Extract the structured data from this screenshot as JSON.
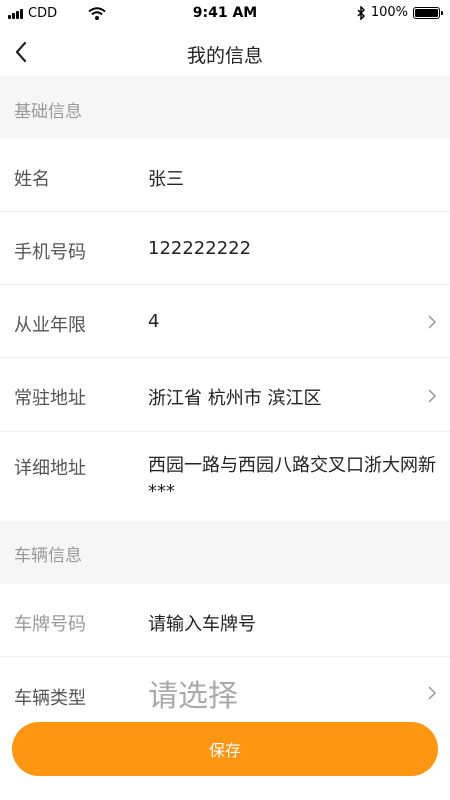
{
  "status_bar": {
    "carrier": "CDD",
    "time": "9:41 AM",
    "battery": "100%"
  },
  "header": {
    "title": "我的信息"
  },
  "sections": {
    "basic": {
      "title": "基础信息"
    },
    "vehicle": {
      "title": "车辆信息"
    }
  },
  "basic_rows": [
    {
      "label": "姓名",
      "value": "张三"
    },
    {
      "label": "手机号码",
      "value": "122222222"
    },
    {
      "label": "从业年限",
      "value": "4"
    },
    {
      "label": "常驻地址",
      "value": "浙江省 杭州市 滨江区"
    },
    {
      "label": "详细地址",
      "value": "西园一路与西园八路交叉口浙大网新***"
    }
  ],
  "vehicle_rows": [
    {
      "label": "车牌号码",
      "placeholder": "请输入车牌号"
    },
    {
      "label": "车辆类型",
      "placeholder": "请选择"
    }
  ],
  "actions": {
    "save_label": "保存"
  },
  "colors": {
    "accent": "#ff9612",
    "section_bg": "#f6f6f6"
  },
  "icons": [
    "signal-icon",
    "wifi-icon",
    "bluetooth-icon",
    "battery-icon",
    "back-arrow-icon",
    "chevron-right-icon"
  ]
}
